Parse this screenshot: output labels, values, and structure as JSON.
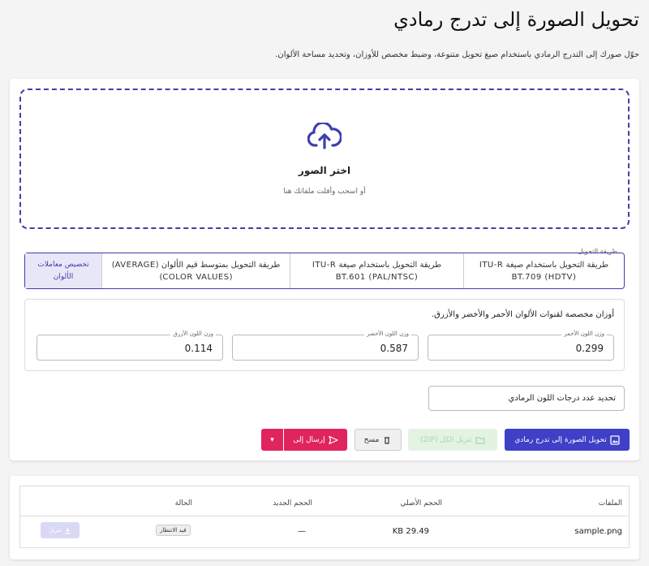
{
  "header": {
    "title": "تحويل الصورة إلى تدرج رمادي",
    "description": "حوّل صورك إلى التدرج الرمادي باستخدام صيغ تحويل متنوعة، وضبط مخصص للأوزان، وتحديد مساحة الألوان."
  },
  "dropzone": {
    "title": "اختر الصور",
    "subtitle": "أو اسحب وأفلت ملفاتك هنا"
  },
  "method": {
    "legend": "طريقة التحويل",
    "options": [
      {
        "label": "طريقة التحويل باستخدام صيغة ITU-R BT.709 (HDTV)",
        "selected": false
      },
      {
        "label": "طريقة التحويل باستخدام صيغة ITU-R BT.601 (PAL/NTSC)",
        "selected": false
      },
      {
        "label": "طريقة التحويل بمتوسط قيم الألوان (AVERAGE) (COLOR VALUES)",
        "selected": false
      },
      {
        "label": "تخصيص معاملات الألوان",
        "selected": true
      }
    ]
  },
  "weights": {
    "title": "أوزان مخصصة لقنوات الألوان الأحمر والأخضر والأزرق.",
    "red": {
      "label": "وزن اللون الأحمر",
      "value": "0.299"
    },
    "green": {
      "label": "وزن اللون الأخضر",
      "value": "0.587"
    },
    "blue": {
      "label": "وزن اللون الأزرق",
      "value": "0.114"
    }
  },
  "levels": {
    "label": "تحديد عدد درجات اللون الرمادي"
  },
  "actions": {
    "convert": "تحويل الصورة إلى تدرج رمادي",
    "zip": "تنزيل الكل (ZIP)",
    "clear": "مسح",
    "send": "إرسال إلى"
  },
  "files_table": {
    "headers": {
      "files": "الملفات",
      "original_size": "الحجم الأصلي",
      "new_size": "الحجم الجديد",
      "status": "الحالة"
    },
    "rows": [
      {
        "name": "sample.png",
        "original_size": "29.49 KB",
        "new_size": "—",
        "status": "قيد الانتظار",
        "download": "تنزيل"
      }
    ]
  },
  "colors": {
    "accent": "#3f3fc8",
    "send": "#e0245e",
    "zip_bg": "#e2f3e4"
  }
}
